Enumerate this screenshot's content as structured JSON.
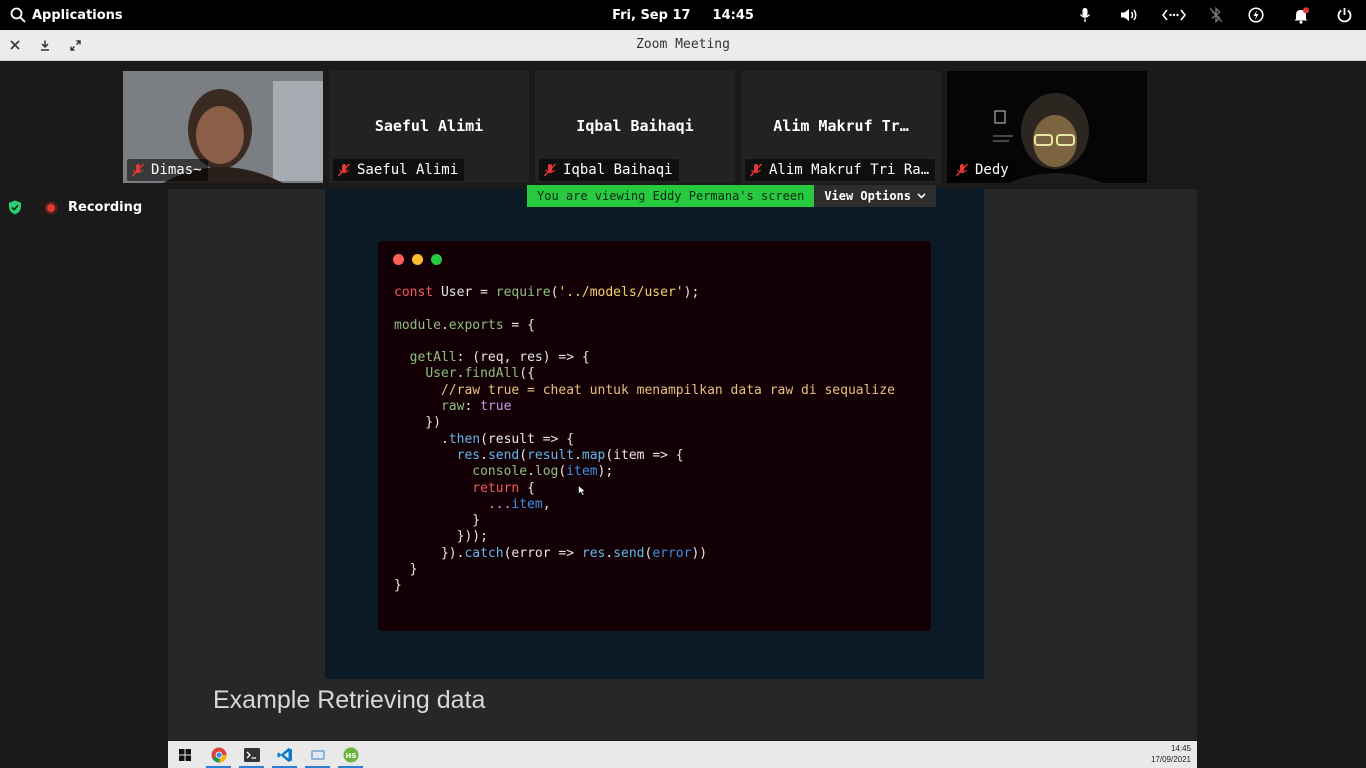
{
  "topbar": {
    "applications_label": "Applications",
    "date": "Fri, Sep 17",
    "time": "14:45",
    "tray_icons": [
      "microphone-icon",
      "volume-icon",
      "network-icon",
      "bluetooth-off-icon",
      "speed-icon",
      "notification-icon",
      "power-icon"
    ]
  },
  "window": {
    "title": "Zoom Meeting",
    "controls": [
      "close-icon",
      "minimize-icon",
      "restore-icon"
    ]
  },
  "participants": [
    {
      "name": "Dimas~",
      "center_name": "",
      "video": true,
      "muted": true
    },
    {
      "name": "Saeful Alimi",
      "center_name": "Saeful Alimi",
      "video": false,
      "muted": true
    },
    {
      "name": "Iqbal Baihaqi",
      "center_name": "Iqbal Baihaqi",
      "video": false,
      "muted": true
    },
    {
      "name": "Alim Makruf Tri Ra…",
      "center_name": "Alim Makruf Tr…",
      "video": false,
      "muted": true
    },
    {
      "name": "Dedy",
      "center_name": "",
      "video": true,
      "muted": true
    }
  ],
  "meeting": {
    "recording_label": "Recording",
    "viewing_banner": "You are viewing Eddy Permana's screen",
    "view_options_label": "View Options"
  },
  "slide": {
    "title": "Example Retrieving data",
    "code_lines": [
      "const User = require('../models/user');",
      "",
      "module.exports = {",
      "",
      "  getAll: (req, res) => {",
      "    User.findAll({",
      "      //raw true = cheat untuk menampilkan data raw di sequalize",
      "      raw: true",
      "    })",
      "      .then(result => {",
      "        res.send(result.map(item => {",
      "          console.log(item);",
      "          return {",
      "            ...item,",
      "          }",
      "        }));",
      "      }).catch(error => res.send(error))",
      "  }",
      "}"
    ]
  },
  "taskbar": {
    "apps": [
      "windows-start-icon",
      "chrome-icon",
      "terminal-icon",
      "vscode-icon",
      "app-icon",
      "hs-icon"
    ],
    "clock_time": "14:45",
    "clock_date": "17/09/2021"
  },
  "colors": {
    "banner_green": "#27c93f",
    "recording_red": "#e53935",
    "security_green": "#2ecc71"
  }
}
